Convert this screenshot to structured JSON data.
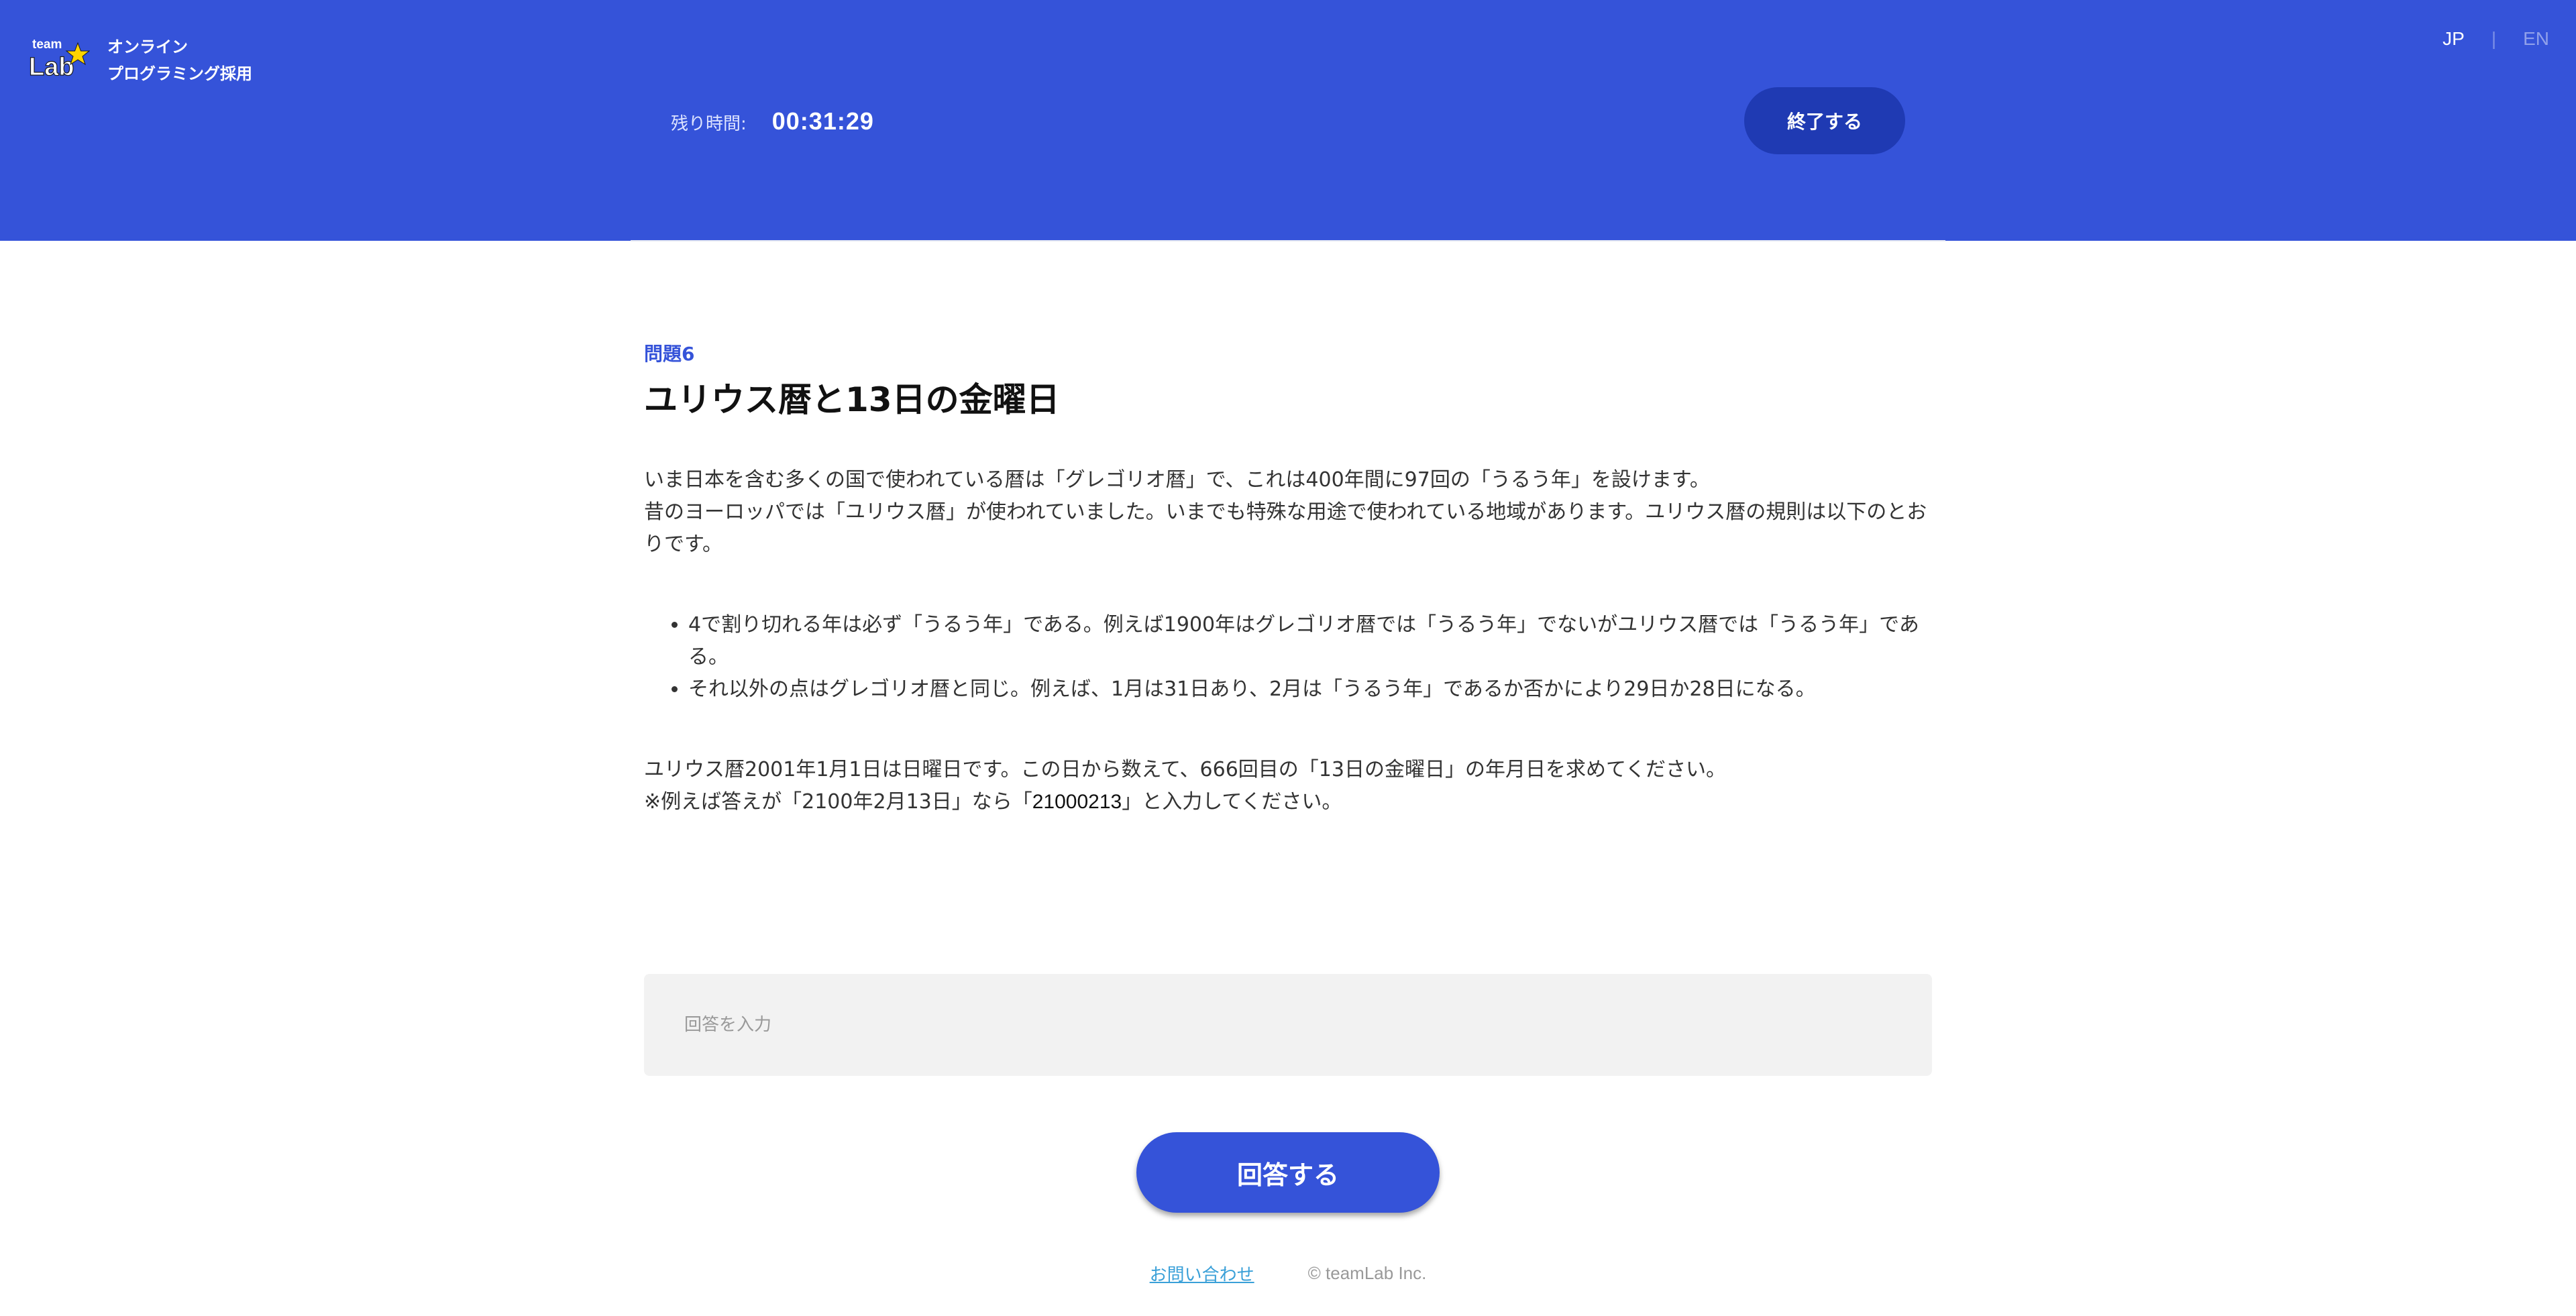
{
  "colors": {
    "brand_blue": "#3553d9",
    "dark_blue_button": "#1f3ab3",
    "input_bg": "#f2f2f2",
    "link": "#3aa0d8"
  },
  "header": {
    "logo_icon": "teamlab-logo-icon",
    "logo_text_top": "team",
    "logo_text_bottom": "Lab",
    "brand_line1": "オンライン",
    "brand_line2": "プログラミング採用",
    "lang_jp": "JP",
    "lang_separator": "|",
    "lang_en": "EN",
    "timer_label": "残り時間:",
    "timer_value": "00:31:29",
    "end_label": "終了する"
  },
  "question": {
    "number": "問題6",
    "title": "ユリウス暦と13日の金曜日",
    "intro_line1": "いま日本を含む多くの国で使われている暦は「グレゴリオ暦」で、これは400年間に97回の「うるう年」を設けます。",
    "intro_line2": "昔のヨーロッパでは「ユリウス暦」が使われていました。いまでも特殊な用途で使われている地域があります。ユリウス暦の規則は以下のとおりです。",
    "rules": [
      "4で割り切れる年は必ず「うるう年」である。例えば1900年はグレゴリオ暦では「うるう年」でないがユリウス暦では「うるう年」である。",
      "それ以外の点はグレゴリオ暦と同じ。例えば、1月は31日あり、2月は「うるう年」であるか否かにより29日か28日になる。"
    ],
    "task_line1": "ユリウス暦2001年1月1日は日曜日です。この日から数えて、666回目の「13日の金曜日」の年月日を求めてください。",
    "task_line2_prefix": "※例えば答えが「2100年2月13日」なら「",
    "task_line2_code": "21000213",
    "task_line2_suffix": "」と入力してください。"
  },
  "answer": {
    "placeholder": "回答を入力",
    "value": "",
    "submit_label": "回答する"
  },
  "footer": {
    "contact_label": "お問い合わせ",
    "copyright": "© teamLab Inc."
  }
}
